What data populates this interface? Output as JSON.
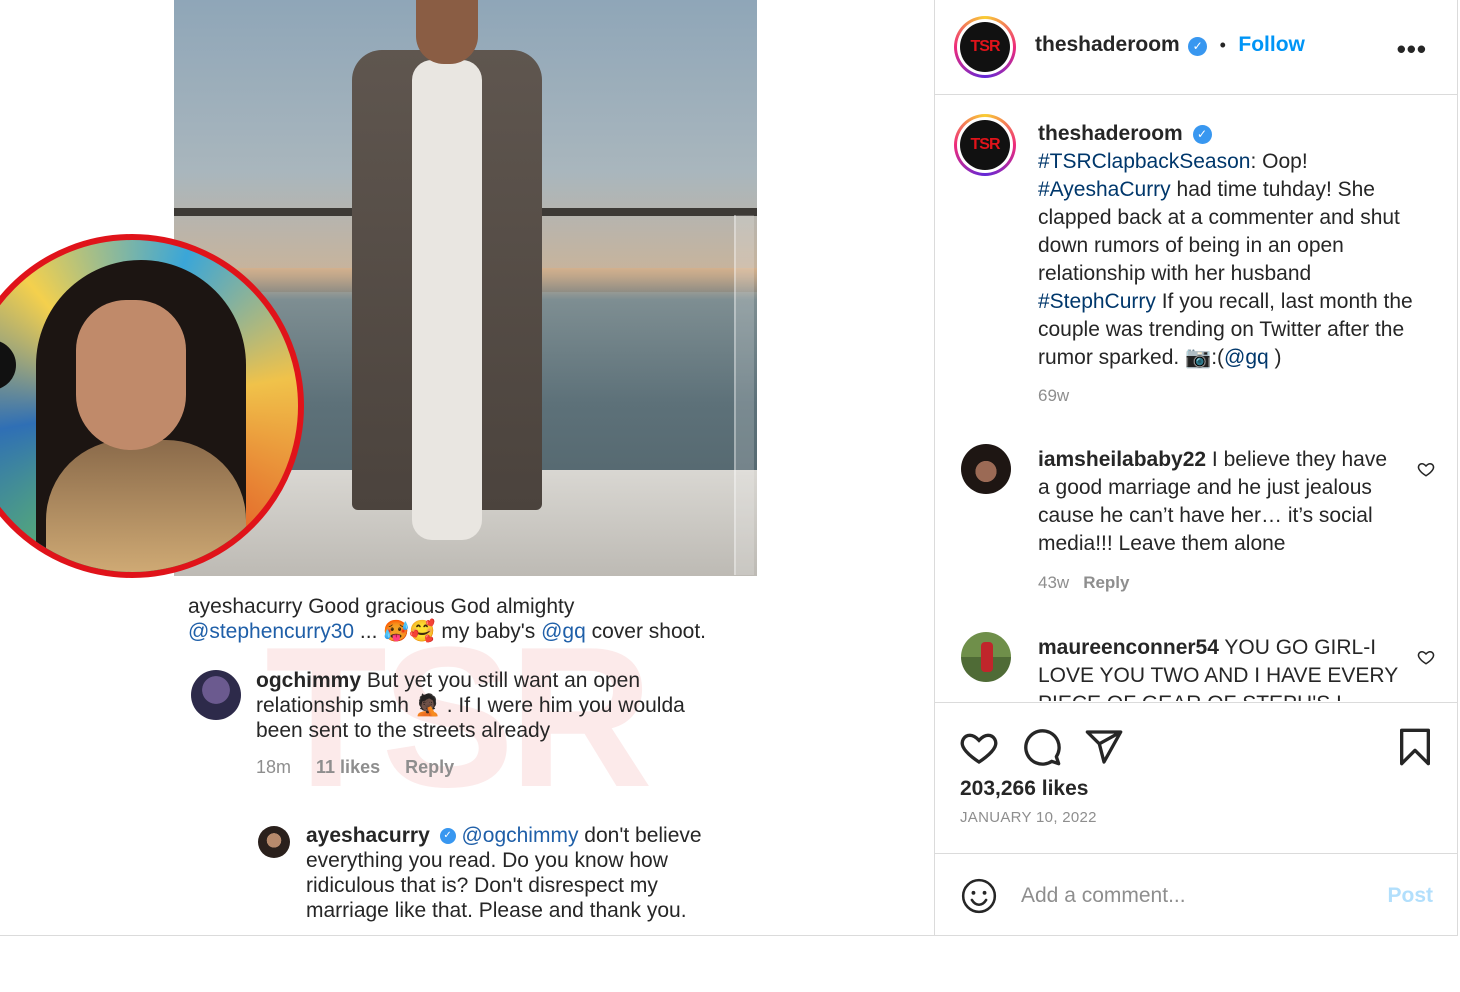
{
  "post": {
    "author": "theshaderoom",
    "follow_label": "Follow",
    "dot": "•",
    "more_label": "•••",
    "verified_mark": "✓",
    "avatar_text": "TSR"
  },
  "caption": {
    "author": "theshaderoom",
    "hashtag1": "#TSRClapbackSeason",
    "part1": ": Oop! ",
    "hashtag2": "#AyeshaCurry",
    "part2": " had time tuhday! She clapped back at a commenter and shut down rumors of being in an open relationship with her husband ",
    "hashtag3": "#StephCurry",
    "part3": " If you recall, last month the couple was trending on Twitter after the rumor sparked. 📷:(",
    "mention": "@gq",
    "part4": " )",
    "time": "69w"
  },
  "comments": [
    {
      "user": "iamsheilababy22",
      "text": " I believe they have a good marriage and he just jealous cause he can’t have her… it’s social media!!! Leave them alone",
      "time": "43w",
      "reply_label": "Reply"
    },
    {
      "user": "maureenconner54",
      "text": " YOU GO GIRL-I LOVE YOU TWO AND I HAVE EVERY PIECE OF GEAR OF STEPH'S I LOVE",
      "time": "",
      "reply_label": ""
    }
  ],
  "screenshot": {
    "line1_user": "ayeshacurry",
    "line1_text": " Good gracious God almighty",
    "line2_mention": "@stephencurry30",
    "line2_text": " ... 🥵🥰 my baby's ",
    "line2_mention2": "@gq",
    "line2_text2": " cover shoot.",
    "reply1_user": "ogchimmy",
    "reply1_text": " But yet you still want an open relationship smh 🤦🏿 . If I were him you woulda been sent to the streets already",
    "reply1_time": "18m",
    "reply1_likes": "11 likes",
    "reply1_reply": "Reply",
    "reply2_user": "ayeshacurry",
    "reply2_mention": "@ogchimmy",
    "reply2_text": " don't believe everything you read. Do you know how ridiculous that is? Don't disrespect my marriage like that. Please and thank you.",
    "watermark": "TSR"
  },
  "stats": {
    "likes": "203,266 likes",
    "date": "JANUARY 10, 2022"
  },
  "composer": {
    "placeholder": "Add a comment...",
    "post_label": "Post"
  },
  "icons": {
    "like": "heart-icon",
    "comment": "comment-icon",
    "share": "share-icon",
    "save": "bookmark-icon",
    "emoji": "emoji-icon",
    "more": "more-icon",
    "verified": "verified-icon"
  },
  "colors": {
    "accent_blue": "#0095f6",
    "hashtag": "#00376b",
    "muted": "#8e8e8e",
    "border": "#dbdbdb",
    "tsr_red": "#e0131a"
  }
}
